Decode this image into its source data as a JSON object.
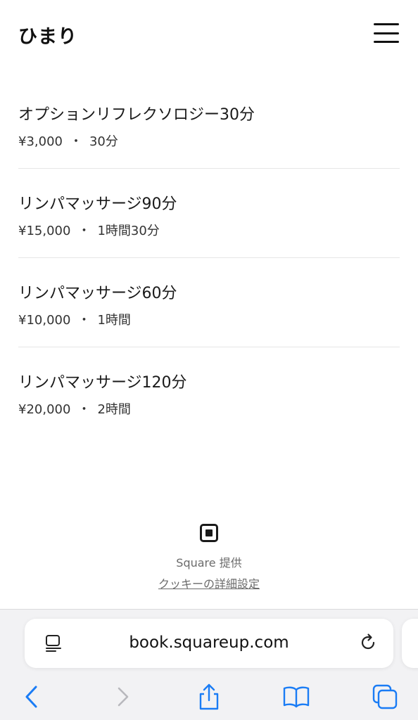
{
  "header": {
    "title": "ひまり",
    "menu_icon": "hamburger-menu-icon"
  },
  "services": [
    {
      "name": "オプションリフレクソロジー30分",
      "price": "¥3,000",
      "separator": "・",
      "duration": "30分"
    },
    {
      "name": "リンパマッサージ90分",
      "price": "¥15,000",
      "separator": "・",
      "duration": "1時間30分"
    },
    {
      "name": "リンパマッサージ60分",
      "price": "¥10,000",
      "separator": "・",
      "duration": "1時間"
    },
    {
      "name": "リンパマッサージ120分",
      "price": "¥20,000",
      "separator": "・",
      "duration": "2時間"
    }
  ],
  "footer": {
    "logo_icon": "square-logo-icon",
    "powered_by": "Square 提供",
    "cookie_settings": "クッキーの詳細設定"
  },
  "browser": {
    "url": "book.squareup.com",
    "accent_color": "#1a7cf5",
    "icons": [
      "reader-icon",
      "reload-icon",
      "back-icon",
      "forward-icon",
      "share-icon",
      "bookmarks-icon",
      "tabs-icon"
    ]
  }
}
